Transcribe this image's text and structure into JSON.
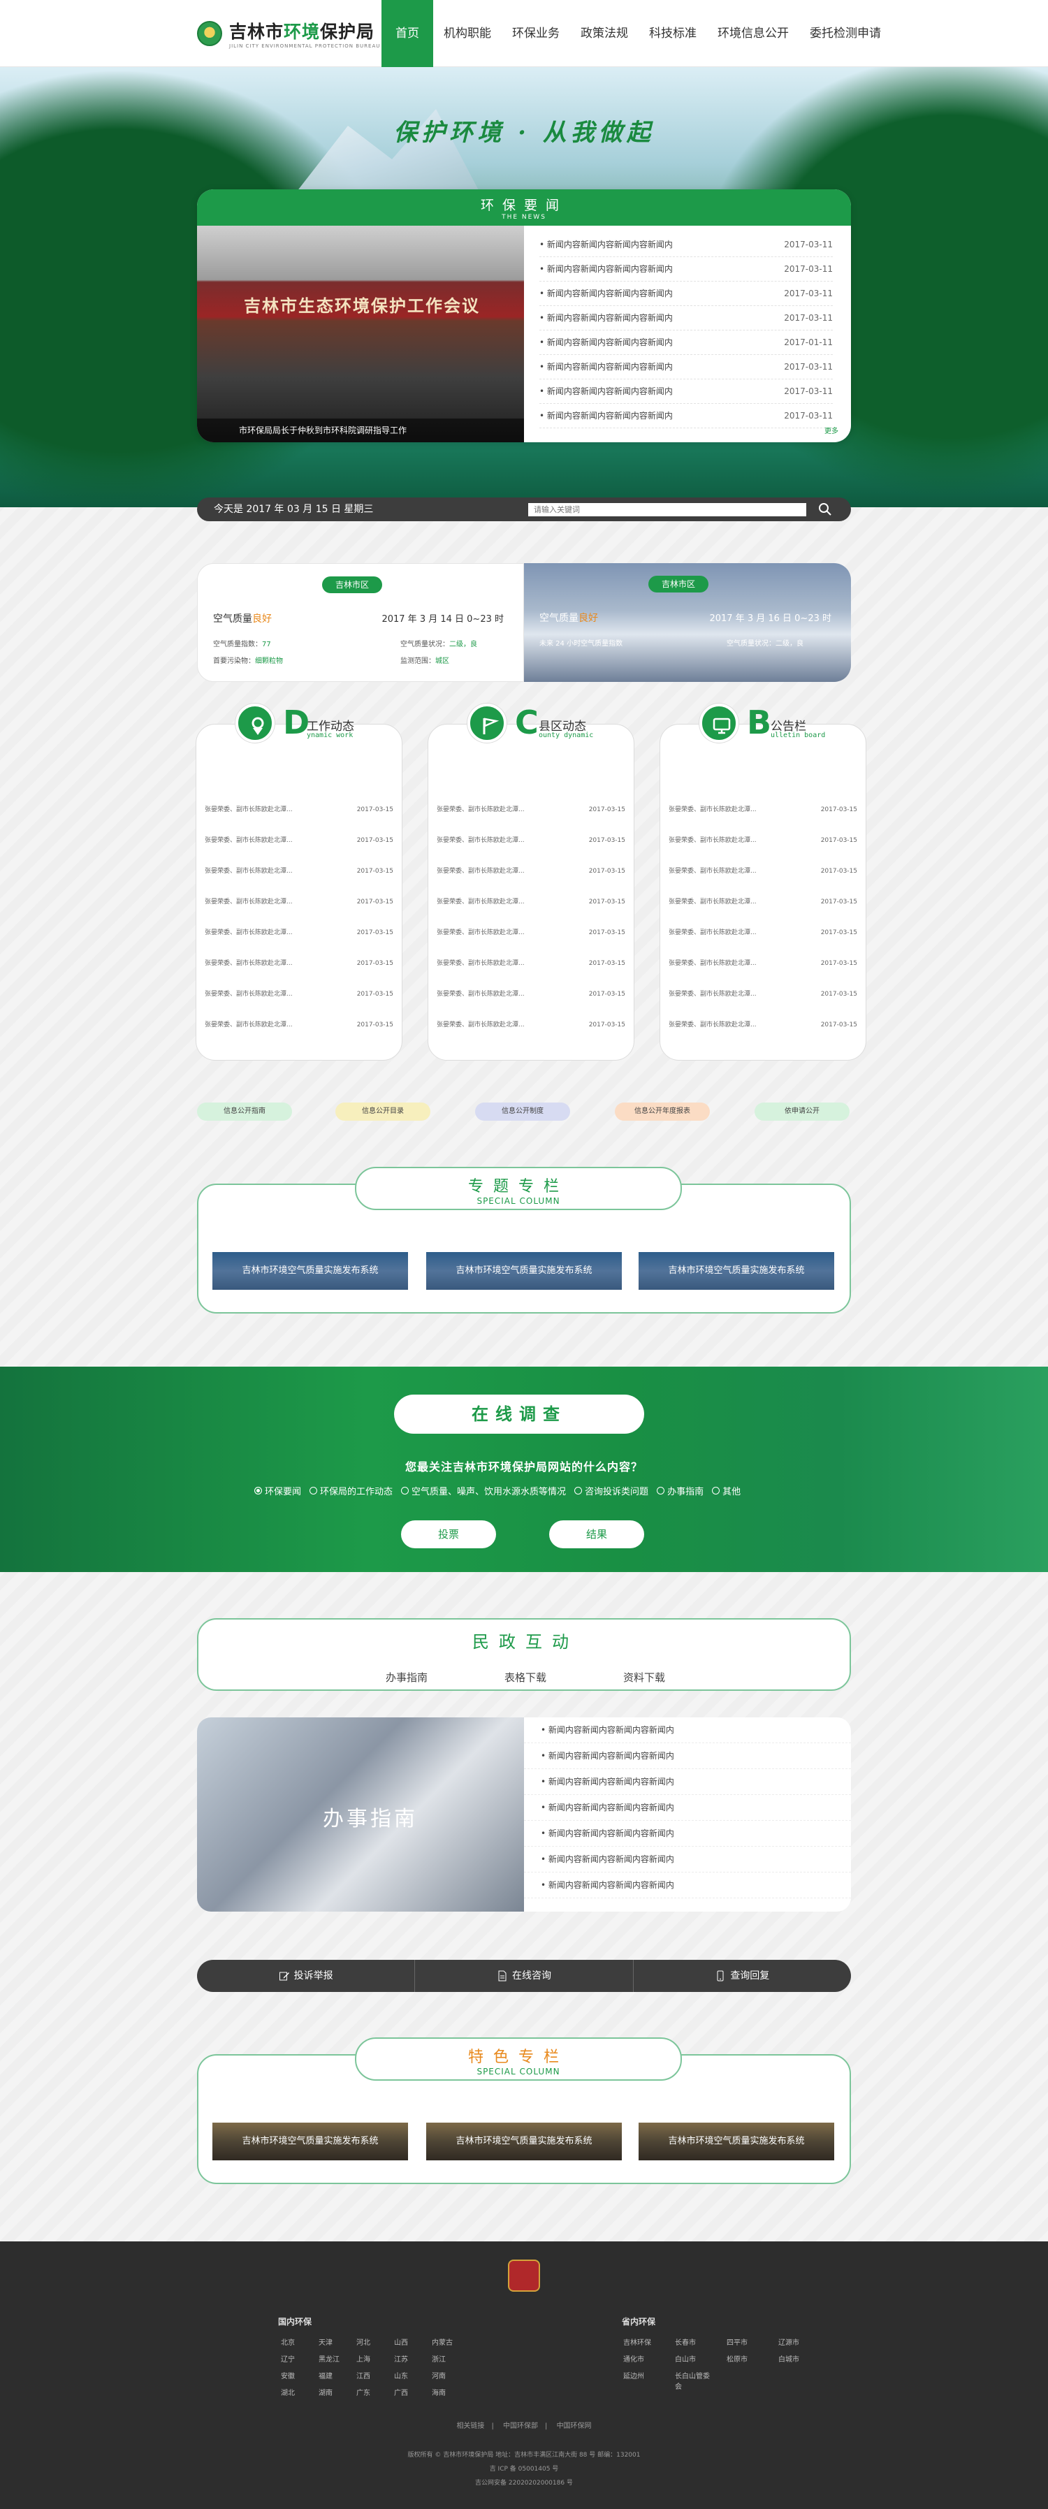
{
  "header": {
    "logo_main": "吉林市",
    "logo_hl": "环境",
    "logo_tail": "保护局",
    "logo_en": "JILIN CITY ENVIRONMENTAL PROTECTION BUREAU",
    "nav": [
      "首页",
      "机构职能",
      "环保业务",
      "政策法规",
      "科技标准",
      "环境信息公开",
      "委托检测申请"
    ]
  },
  "banner": {
    "slogan": "保护环境 · 从我做起"
  },
  "news": {
    "title": "环保要闻",
    "subtitle": "THE NEWS",
    "photo_banner": "吉林市生态环境保护工作会议",
    "photo_caption": "市环保局局长于仲秋到市环科院调研指导工作",
    "items": [
      {
        "text": "• 新闻内容新闻内容新闻内容新闻内",
        "date": "2017-03-11"
      },
      {
        "text": "• 新闻内容新闻内容新闻内容新闻内",
        "date": "2017-03-11"
      },
      {
        "text": "• 新闻内容新闻内容新闻内容新闻内",
        "date": "2017-03-11"
      },
      {
        "text": "• 新闻内容新闻内容新闻内容新闻内",
        "date": "2017-03-11"
      },
      {
        "text": "• 新闻内容新闻内容新闻内容新闻内",
        "date": "2017-01-11"
      },
      {
        "text": "• 新闻内容新闻内容新闻内容新闻内",
        "date": "2017-03-11"
      },
      {
        "text": "• 新闻内容新闻内容新闻内容新闻内",
        "date": "2017-03-11"
      },
      {
        "text": "• 新闻内容新闻内容新闻内容新闻内",
        "date": "2017-03-11"
      }
    ],
    "more": "更多"
  },
  "infobar": {
    "date": "今天是 2017 年 03 月 15 日  星期三",
    "search_placeholder": "请输入关键词"
  },
  "air": {
    "left": {
      "tag": "吉林市区",
      "label": "空气质量",
      "level": "良好",
      "time": "2017 年 3 月 14 日 0~23 时",
      "f1": "空气质量指数：",
      "f1v": "77",
      "f2": "空气质量状况：",
      "f2v": "二级，良",
      "f3": "首要污染物：",
      "f3v": "细颗粒物",
      "f4": "监测范围：",
      "f4v": "城区"
    },
    "right": {
      "tag": "吉林市区",
      "label": "空气质量",
      "level": "良好",
      "time": "2017 年 3 月 16 日 0~23 时",
      "f1": "未来 24 小时空气质量指数",
      "f2": "空气质量状况：",
      "f2v": "二级，良"
    }
  },
  "columns": [
    {
      "letter": "D",
      "cn": "工作动态",
      "en": "ynamic work"
    },
    {
      "letter": "C",
      "cn": "县区动态",
      "en": "ounty dynamic"
    },
    {
      "letter": "B",
      "cn": "公告栏",
      "en": "ulletin board"
    }
  ],
  "column_row": {
    "text": "张晏荣委、副市长陈欧赴北潭...",
    "date": "2017-03-15"
  },
  "pills": [
    "信息公开指南",
    "信息公开目录",
    "信息公开制度",
    "信息公开年度报表",
    "依申请公开"
  ],
  "pill_colors": [
    "#d6f2dd",
    "#f7efbd",
    "#d7dbf2",
    "#fbdcc4",
    "#d6f2dd"
  ],
  "special1": {
    "title": "专题专栏",
    "subtitle": "SPECIAL COLUMN",
    "cards": [
      "吉林市环境空气质量实施发布系统",
      "吉林市环境空气质量实施发布系统",
      "吉林市环境空气质量实施发布系统"
    ]
  },
  "survey": {
    "title": "在线调查",
    "question": "您最关注吉林市环境保护局网站的什么内容？",
    "options": [
      "环保要闻",
      "环保局的工作动态",
      "空气质量、噪声、饮用水源水质等情况",
      "咨询投诉类问题",
      "办事指南",
      "其他"
    ],
    "vote": "投票",
    "result": "结果"
  },
  "mz": {
    "title": "民政互动",
    "tabs": [
      "办事指南",
      "表格下载",
      "资料下载"
    ],
    "pic_label": "办事指南",
    "items": [
      "• 新闻内容新闻内容新闻内容新闻内",
      "• 新闻内容新闻内容新闻内容新闻内",
      "• 新闻内容新闻内容新闻内容新闻内",
      "• 新闻内容新闻内容新闻内容新闻内",
      "• 新闻内容新闻内容新闻内容新闻内",
      "• 新闻内容新闻内容新闻内容新闻内",
      "• 新闻内容新闻内容新闻内容新闻内"
    ]
  },
  "actions": [
    "投诉举报",
    "在线咨询",
    "查询回复"
  ],
  "special2": {
    "title": "特色专栏",
    "subtitle": "SPECIAL COLUMN",
    "cards": [
      "吉林市环境空气质量实施发布系统",
      "吉林市环境空气质量实施发布系统",
      "吉林市环境空气质量实施发布系统"
    ]
  },
  "footer": {
    "domestic_title": "国内环保",
    "domestic": [
      "北京",
      "天津",
      "河北",
      "山西",
      "内蒙古",
      "辽宁",
      "黑龙江",
      "上海",
      "江苏",
      "浙江",
      "安徽",
      "福建",
      "江西",
      "山东",
      "河南",
      "湖北",
      "湖南",
      "广东",
      "广西",
      "海南"
    ],
    "province_title": "省内环保",
    "province": [
      "吉林环保",
      "长春市",
      "四平市",
      "辽源市",
      "通化市",
      "白山市",
      "松原市",
      "白城市",
      "延边州",
      "长白山管委会"
    ],
    "links": [
      "相关链接",
      "中国环保部",
      "中国环保网"
    ],
    "line1": "版权所有 © 吉林市环境保护局   地址：吉林市丰满区江南大街 88 号   邮编：132001",
    "line2": "吉 ICP 备 05001405 号",
    "line3": "吉公网安备 22020202000186 号"
  }
}
